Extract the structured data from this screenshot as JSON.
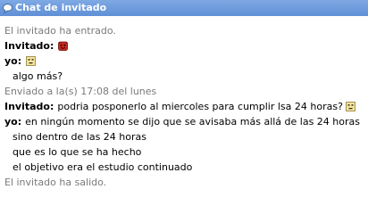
{
  "window": {
    "title": "Chat de invitado",
    "title_icon": "speech-bubble-icon"
  },
  "messages": [
    {
      "type": "system",
      "text": "El invitado ha entrado."
    },
    {
      "type": "sender",
      "sender": "Invitado:",
      "avatar": "red-devil-avatar-icon"
    },
    {
      "type": "sender",
      "sender": "yo:",
      "avatar": "yellow-face-avatar-icon"
    },
    {
      "type": "text",
      "text": "algo más?"
    },
    {
      "type": "system",
      "text": "Enviado a la(s) 17:08 del lunes"
    },
    {
      "type": "message",
      "sender": "Invitado:",
      "text": "podria posponerlo al miercoles para cumplir lsa 24 horas?",
      "avatar": "yellow-face-avatar-icon"
    },
    {
      "type": "message",
      "sender": "yo:",
      "text": "en ningún momento se dijo que se avisaba más allá de las 24 horas"
    },
    {
      "type": "text",
      "text": "sino dentro de las 24 horas"
    },
    {
      "type": "text",
      "text": "que es lo que se ha hecho"
    },
    {
      "type": "text",
      "text": "el objetivo era el estudio continuado"
    },
    {
      "type": "system",
      "text": "El invitado ha salido."
    }
  ],
  "colors": {
    "titlebar": "#5f8fd6",
    "system_text": "#7a7a7a"
  }
}
